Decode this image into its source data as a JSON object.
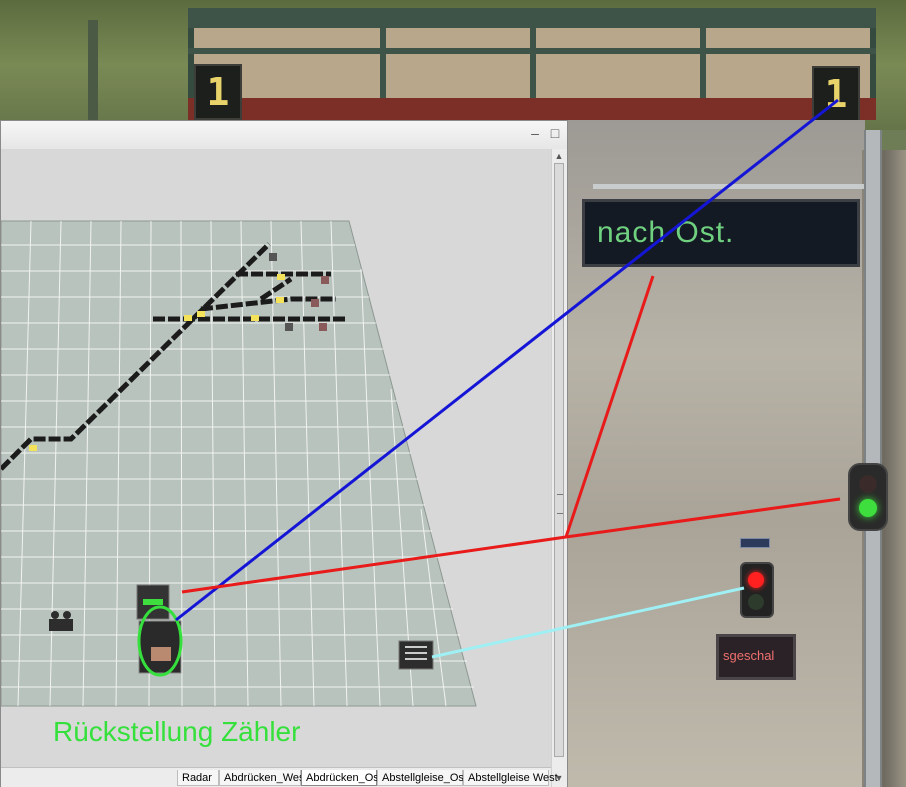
{
  "window": {
    "minimize_glyph": "–",
    "maximize_glyph": "□"
  },
  "scene": {
    "counter_left": "1",
    "counter_right": "1",
    "destination_board": "nach Ost.",
    "small_board": "sgeschal"
  },
  "layout_caption": "Rückstellung Zähler",
  "tabs": [
    "Radar",
    "Abdrücken_West",
    "Abdrücken_Ost",
    "Abstellgleise_Ost",
    "Abstellgleise West"
  ],
  "active_tab": "Abdrücken_Ost",
  "colors": {
    "annotation_blue": "#1515d6",
    "annotation_red": "#e81a1a",
    "annotation_cyan": "#9ff0f4",
    "caption_green": "#36e03c",
    "signal_green": "#3dde3d",
    "signal_red": "#ff2020"
  }
}
